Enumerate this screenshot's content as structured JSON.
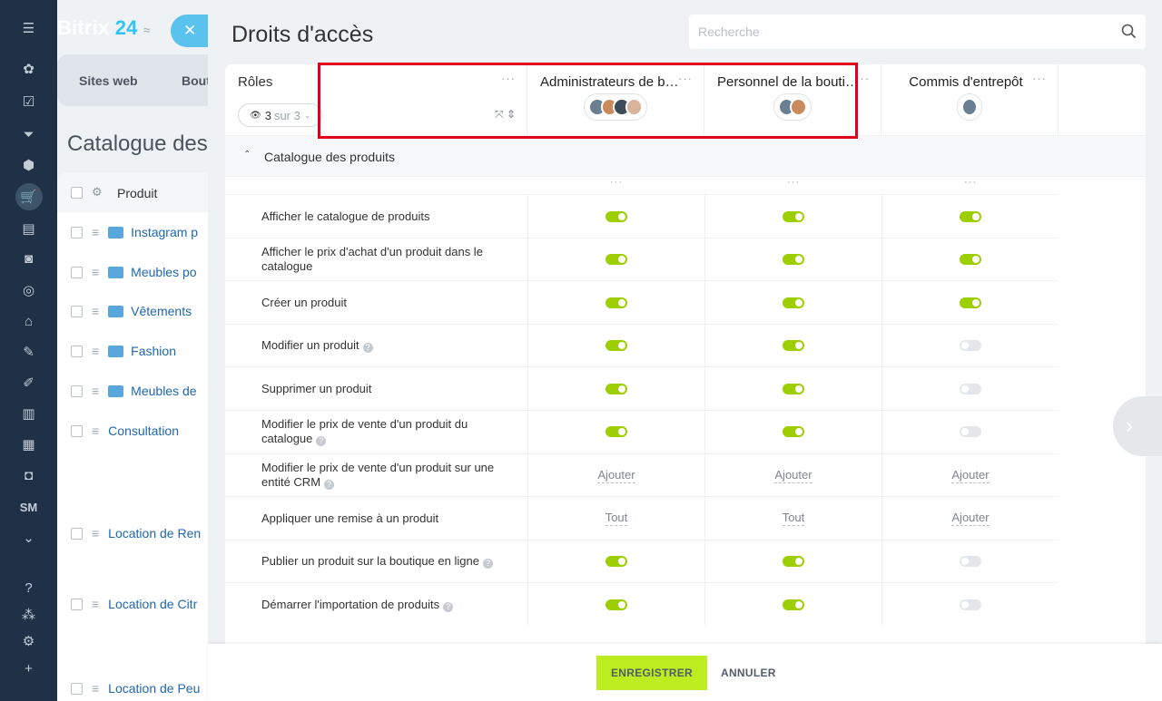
{
  "background": {
    "brand_name": "Bitrix",
    "brand_number": "24",
    "brand_sep": "≈",
    "tabs": [
      "Sites web",
      "Bout"
    ],
    "page_title": "Catalogue des",
    "header_col": "Produit",
    "rows": [
      {
        "label": "Instagram p",
        "folder": true
      },
      {
        "label": "Meubles po",
        "folder": true
      },
      {
        "label": "Vêtements",
        "folder": true
      },
      {
        "label": "Fashion",
        "folder": true
      },
      {
        "label": "Meubles de",
        "folder": true
      },
      {
        "label": "Consultation",
        "folder": false
      },
      {
        "label": "Location de Ren",
        "folder": false
      },
      {
        "label": "Location de Citr",
        "folder": false
      },
      {
        "label": "Location de Peu",
        "folder": false
      }
    ]
  },
  "sidebar": {
    "sm_label": "SM",
    "icons": [
      "menu-icon",
      "feed-icon",
      "tasks-icon",
      "crm-icon",
      "inventory-icon",
      "shop-icon",
      "contacts-icon",
      "robot-icon",
      "target-icon",
      "bank-icon",
      "sign-icon",
      "forms-icon",
      "analytics-icon",
      "calendar-icon",
      "video-icon",
      "sm-icon",
      "more-icon",
      "help-icon",
      "structure-icon",
      "settings-icon",
      "add-icon"
    ]
  },
  "slider": {
    "title": "Droits d'accès",
    "search_placeholder": "Recherche"
  },
  "table": {
    "roles_label": "Rôles",
    "counter_value": "3",
    "counter_total": "sur 3",
    "columns": [
      {
        "name": "Administrateurs de boutique",
        "avatars": 4
      },
      {
        "name": "Personnel de la boutique",
        "avatars": 2
      },
      {
        "name": "Commis d'entrepôt",
        "avatars": 1
      }
    ],
    "group_label": "Catalogue des produits",
    "rows": [
      {
        "label": "Afficher le catalogue de produits",
        "help": false,
        "values": [
          "on",
          "on",
          "on"
        ]
      },
      {
        "label": "Afficher le prix d'achat d'un produit dans le catalogue",
        "help": false,
        "values": [
          "on",
          "on",
          "on"
        ]
      },
      {
        "label": "Créer un produit",
        "help": false,
        "values": [
          "on",
          "on",
          "on"
        ]
      },
      {
        "label": "Modifier un produit",
        "help": true,
        "values": [
          "on",
          "on",
          "off"
        ]
      },
      {
        "label": "Supprimer un produit",
        "help": false,
        "values": [
          "on",
          "on",
          "off"
        ]
      },
      {
        "label": "Modifier le prix de vente d'un produit du catalogue",
        "help": true,
        "values": [
          "on",
          "on",
          "off"
        ]
      },
      {
        "label": "Modifier le prix de vente d'un produit sur une entité CRM",
        "help": true,
        "values": [
          "Ajouter",
          "Ajouter",
          "Ajouter"
        ]
      },
      {
        "label": "Appliquer une remise à un produit",
        "help": false,
        "values": [
          "Tout",
          "Tout",
          "Ajouter"
        ]
      },
      {
        "label": "Publier un produit sur la boutique en ligne",
        "help": true,
        "values": [
          "on",
          "on",
          "off"
        ]
      },
      {
        "label": "Démarrer l'importation de produits",
        "help": true,
        "values": [
          "on",
          "on",
          "off"
        ]
      }
    ]
  },
  "footer": {
    "save_label": "ENREGISTRER",
    "cancel_label": "ANNULER"
  },
  "colors": {
    "toggle_on": "#9dcf00",
    "toggle_off": "#e4e7ea",
    "highlight": "#e0001b",
    "sidebar_bg": "#1f3147",
    "save_button": "#bbed21"
  }
}
